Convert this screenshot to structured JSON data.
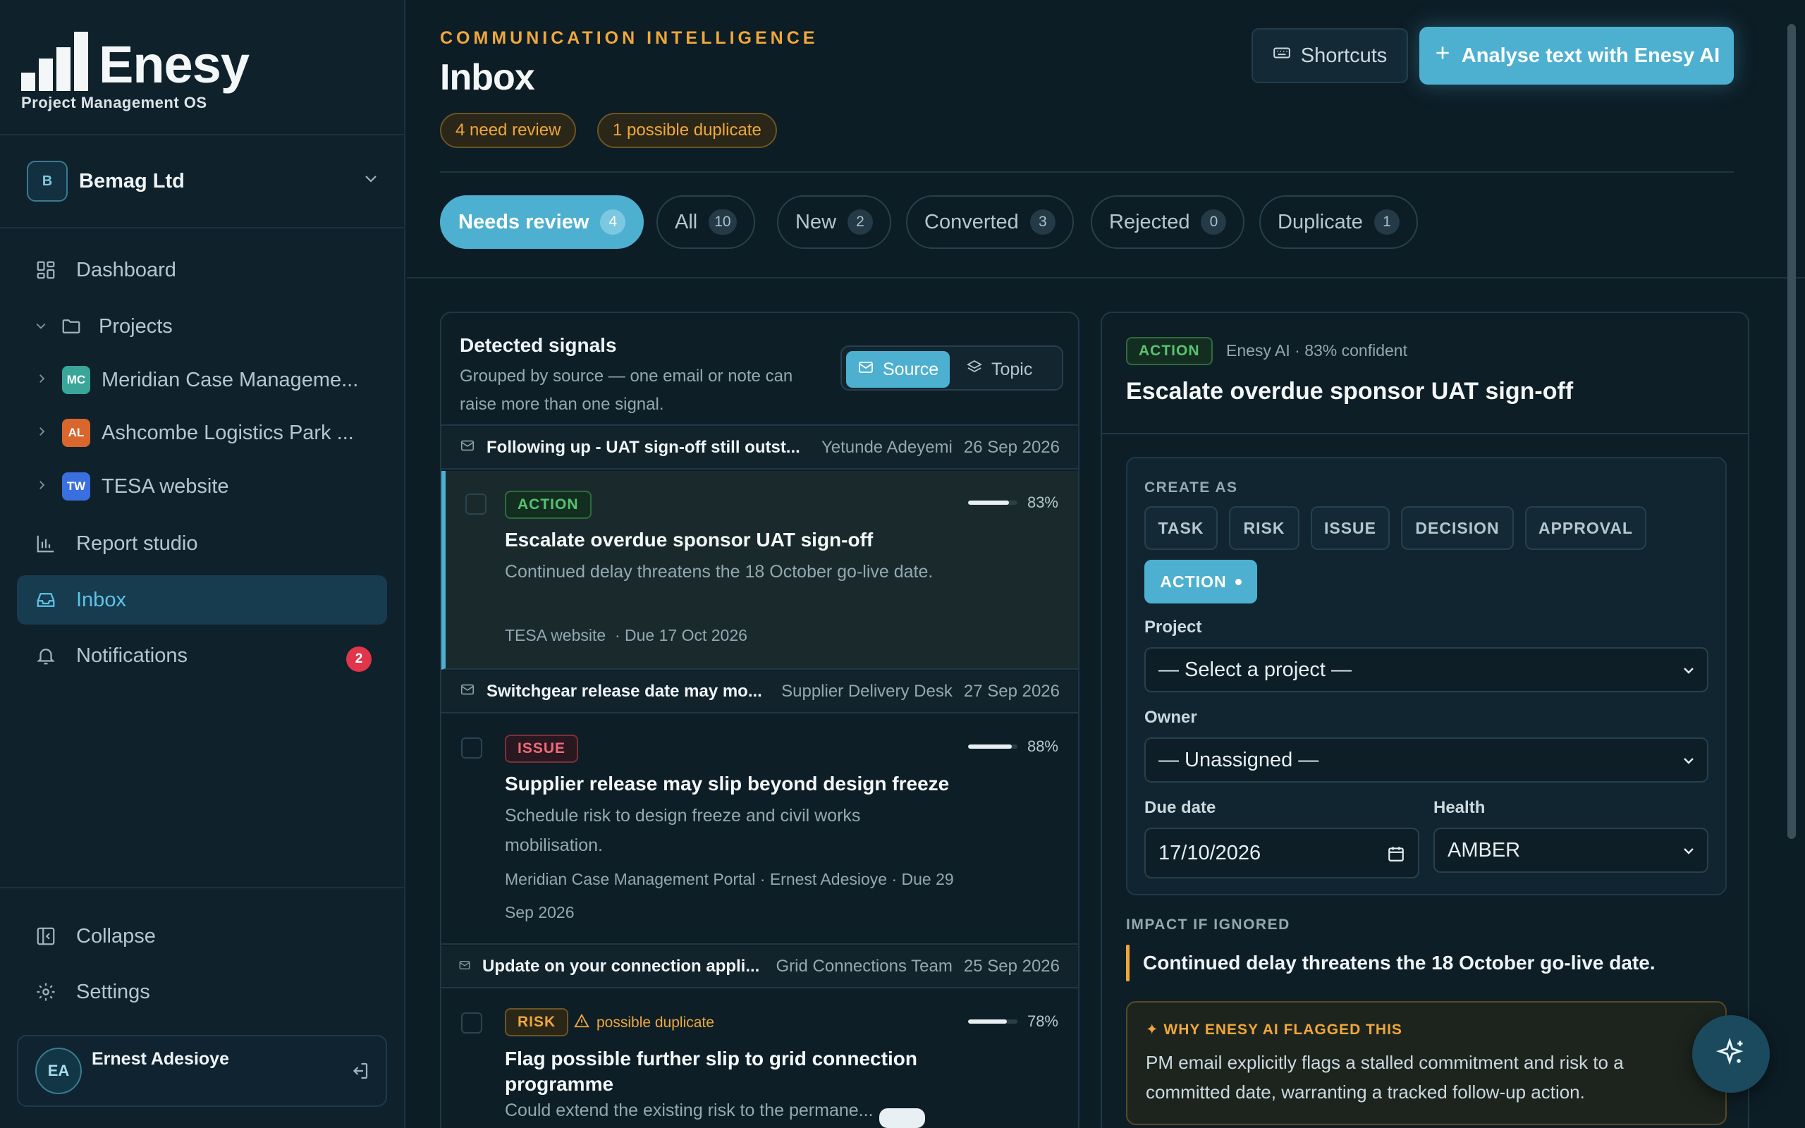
{
  "brand": {
    "name": "Enesy",
    "tagline": "Project Management OS"
  },
  "org": {
    "initial": "B",
    "name": "Bemag Ltd"
  },
  "nav": {
    "dashboard": "Dashboard",
    "projects": "Projects",
    "report_studio": "Report studio",
    "inbox": "Inbox",
    "notifications": "Notifications",
    "notifications_count": "2",
    "collapse": "Collapse",
    "settings": "Settings"
  },
  "projects": [
    {
      "initials": "MC",
      "name": "Meridian Case Manageme...",
      "color": "#3aa69a"
    },
    {
      "initials": "AL",
      "name": "Ashcombe Logistics Park ...",
      "color": "#d9662c"
    },
    {
      "initials": "TW",
      "name": "TESA website",
      "color": "#3a6fe0"
    }
  ],
  "user": {
    "initials": "EA",
    "name": "Ernest Adesioye"
  },
  "header": {
    "eyebrow": "COMMUNICATION INTELLIGENCE",
    "title": "Inbox",
    "review_pill": "4 need review",
    "duplicate_pill": "1 possible duplicate",
    "shortcuts": "Shortcuts",
    "analyse": "Analyse text with Enesy AI"
  },
  "tabs": [
    {
      "label": "Needs review",
      "count": "4"
    },
    {
      "label": "All",
      "count": "10"
    },
    {
      "label": "New",
      "count": "2"
    },
    {
      "label": "Converted",
      "count": "3"
    },
    {
      "label": "Rejected",
      "count": "0"
    },
    {
      "label": "Duplicate",
      "count": "1"
    }
  ],
  "signals": {
    "title": "Detected signals",
    "subtitle": "Grouped by source — one email or note can raise more than one signal.",
    "group_source": "Source",
    "group_topic": "Topic",
    "groups": [
      {
        "subject": "Following up - UAT sign-off still outst...",
        "from": "Yetunde Adeyemi",
        "date": "26 Sep 2026",
        "item": {
          "tag": "ACTION",
          "confidence": "83%",
          "confidence_value": 0.83,
          "title": "Escalate overdue sponsor UAT sign-off",
          "desc": "Continued delay threatens the 18 October go-live date.",
          "meta": "TESA website  · Due 17 Oct 2026"
        }
      },
      {
        "subject": "Switchgear release date may mo...",
        "from": "Supplier Delivery Desk",
        "date": "27 Sep 2026",
        "item": {
          "tag": "ISSUE",
          "confidence": "88%",
          "confidence_value": 0.88,
          "title": "Supplier release may slip beyond design freeze",
          "desc": "Schedule risk to design freeze and civil works mobilisation.",
          "meta": "Meridian Case Management Portal  · Ernest Adesioye  · Due 29 Sep 2026"
        }
      },
      {
        "subject": "Update on your connection appli...",
        "from": "Grid Connections Team",
        "date": "25 Sep 2026",
        "item": {
          "tag": "RISK",
          "dup_note": "possible duplicate",
          "confidence": "78%",
          "confidence_value": 0.78,
          "title": "Flag possible further slip to grid connection programme",
          "desc": "Could extend the existing risk to the permane..."
        }
      }
    ]
  },
  "detail": {
    "tag": "ACTION",
    "ai_line": "Enesy AI · 83% confident",
    "title": "Escalate overdue sponsor UAT sign-off",
    "create_as_caption": "CREATE AS",
    "types": [
      "TASK",
      "RISK",
      "ISSUE",
      "DECISION",
      "APPROVAL"
    ],
    "active_type": "ACTION",
    "project_label": "Project",
    "project_value": "— Select a project —",
    "owner_label": "Owner",
    "owner_value": "— Unassigned —",
    "due_label": "Due date",
    "due_value": "17/10/2026",
    "health_label": "Health",
    "health_value": "AMBER",
    "impact_caption": "IMPACT IF IGNORED",
    "impact_text": "Continued delay threatens the 18 October go-live date.",
    "why_caption": "✦ WHY ENESY AI FLAGGED THIS",
    "why_text": "PM email explicitly flags a stalled commitment and risk to a committed date, warranting a tracked follow-up action."
  },
  "icons": {
    "dashboard": "dashboard-icon",
    "projects": "folder-icon",
    "report": "bar-chart-icon",
    "inbox": "inbox-icon",
    "notifications": "bell-icon",
    "collapse": "collapse-icon",
    "settings": "gear-icon",
    "logout": "logout-icon",
    "keyboard": "keyboard-icon",
    "plus": "plus-icon",
    "mail": "mail-icon",
    "layers": "layers-icon",
    "warning": "warning-icon",
    "calendar": "calendar-icon",
    "sparkle": "sparkle-icon"
  },
  "colors": {
    "accent": "#4db0d0",
    "warning": "#f0a73a",
    "danger": "#e0354b",
    "success": "#58c270"
  }
}
